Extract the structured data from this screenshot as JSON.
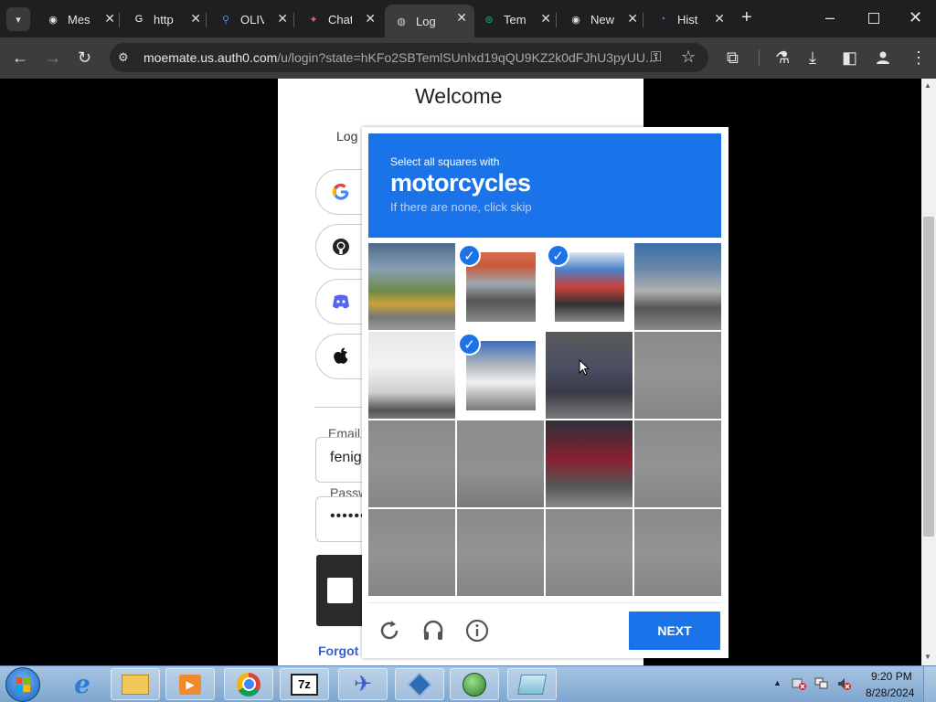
{
  "browser": {
    "tabs": [
      {
        "title": "Mes",
        "icon": "messenger-icon",
        "color": "#e6e6e6"
      },
      {
        "title": "http",
        "icon": "google-icon",
        "color": "#ffffff"
      },
      {
        "title": "OLIV",
        "icon": "search-icon",
        "color": "#4a8bf5"
      },
      {
        "title": "Chat",
        "icon": "chat-icon",
        "color": "#d65aa5"
      },
      {
        "title": "Log",
        "icon": "globe-icon",
        "color": "#cfcfcf"
      },
      {
        "title": "Tem",
        "icon": "chatgpt-icon",
        "color": "#19a37f"
      },
      {
        "title": "New",
        "icon": "chrome-icon",
        "color": "#dddddd"
      },
      {
        "title": "Hist",
        "icon": "history-icon",
        "color": "#4a8bf5"
      }
    ],
    "url_main": "moemate.us.auth0.com",
    "url_rest": "/u/login?state=hKFo2SBTemlSUnlxd19qQU9KZ2k0dFJhU3pyUU..."
  },
  "login": {
    "welcome": "Welcome",
    "login_to": "Log",
    "email_label": "Email",
    "email_value": "fenig",
    "password_label": "Passw",
    "password_value": "•••••••",
    "forgot": "Forgot"
  },
  "captcha": {
    "instruction": "Select all squares with",
    "target": "motorcycles",
    "skip_hint": "If there are none, click skip",
    "next_label": "NEXT",
    "tiles": [
      {
        "row": 0,
        "col": 0,
        "selected": false
      },
      {
        "row": 0,
        "col": 1,
        "selected": true
      },
      {
        "row": 0,
        "col": 2,
        "selected": true
      },
      {
        "row": 0,
        "col": 3,
        "selected": false
      },
      {
        "row": 1,
        "col": 0,
        "selected": false
      },
      {
        "row": 1,
        "col": 1,
        "selected": true
      },
      {
        "row": 1,
        "col": 2,
        "selected": false
      },
      {
        "row": 1,
        "col": 3,
        "selected": false
      },
      {
        "row": 2,
        "col": 0,
        "selected": false
      },
      {
        "row": 2,
        "col": 1,
        "selected": false
      },
      {
        "row": 2,
        "col": 2,
        "selected": false
      },
      {
        "row": 2,
        "col": 3,
        "selected": false
      },
      {
        "row": 3,
        "col": 0,
        "selected": false
      },
      {
        "row": 3,
        "col": 1,
        "selected": false
      },
      {
        "row": 3,
        "col": 2,
        "selected": false
      },
      {
        "row": 3,
        "col": 3,
        "selected": false
      }
    ]
  },
  "taskbar": {
    "time": "9:20 PM",
    "date": "8/28/2024",
    "apps": [
      "start-orb-icon",
      "internet-explorer-icon",
      "file-explorer-icon",
      "media-player-icon",
      "chrome-icon",
      "7zip-icon",
      "bird-app-icon",
      "virtualbox-icon",
      "globe-app-icon",
      "notepad-app-icon"
    ]
  },
  "colors": {
    "accent": "#1a73e8",
    "chrome_dark": "#3c3c3c"
  }
}
